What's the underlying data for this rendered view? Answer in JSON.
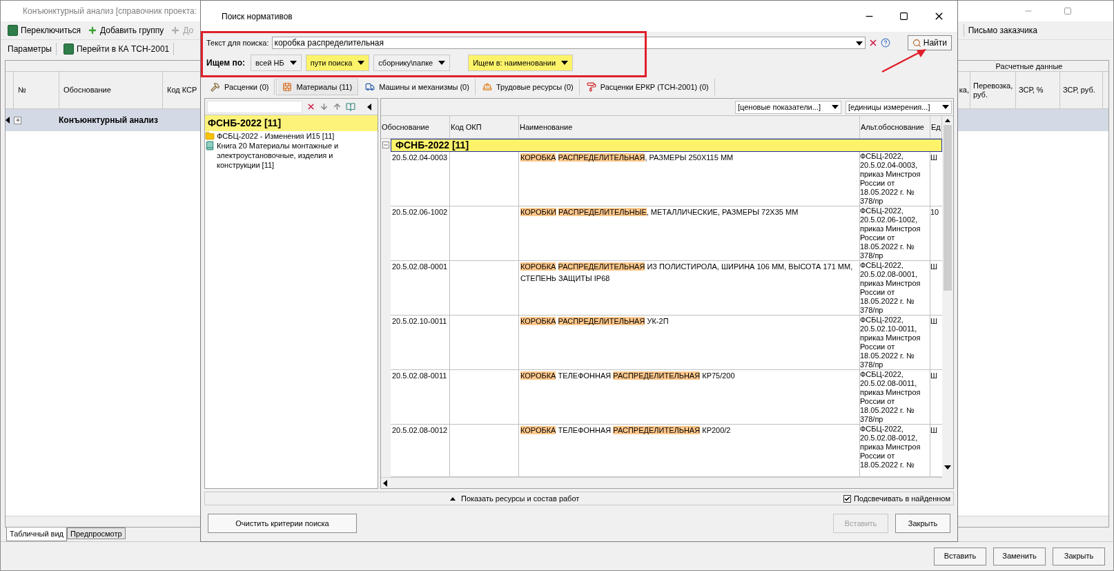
{
  "background_window": {
    "title": "Конъюнктурный анализ [справочник проекта:",
    "toolbar_1": [
      {
        "label": "Переключиться",
        "kind": "app",
        "disabled": false
      },
      {
        "label": "Добавить группу",
        "kind": "add",
        "disabled": false
      },
      {
        "label": "До",
        "kind": "add",
        "disabled": true
      }
    ],
    "letter_button": "Письмо заказчика",
    "toolbar_2": [
      {
        "label": "Параметры",
        "kind": "plain"
      },
      {
        "label": "Перейти в КА ТСН-2001",
        "kind": "app"
      }
    ],
    "table": {
      "group_header": "Расчетные данные",
      "columns_left": [
        "№",
        "Обоснование",
        "Код КСР"
      ],
      "columns_right": [
        "ка,",
        "Перевозка, руб.",
        "ЗСР, %",
        "ЗСР, руб."
      ],
      "rows": [
        {
          "title": "Конъюнктурный анализ",
          "selected": true,
          "expanded": false
        }
      ]
    },
    "view_tabs": [
      {
        "label": "Табличный вид",
        "selected": true
      },
      {
        "label": "Предпросмотр",
        "selected": false
      }
    ],
    "buttons": [
      "Вставить",
      "Заменить",
      "Закрыть"
    ]
  },
  "dialog": {
    "title": "Поиск нормативов",
    "search": {
      "label": "Текст для поиска:",
      "value": "коробка распределительная",
      "find_button": "Найти"
    },
    "filters": {
      "label": "Ищем по:",
      "dropdowns": [
        {
          "label": "всей НБ",
          "highlighted": false
        },
        {
          "label": "пути поиска",
          "highlighted": true
        },
        {
          "label": "сборнику\\папке",
          "highlighted": false
        },
        {
          "label": "Ищем в: наименовании",
          "highlighted": true
        }
      ]
    },
    "tabs": [
      {
        "label": "Расценки (0)",
        "kind": "hammer",
        "selected": false
      },
      {
        "label": "Материалы (11)",
        "kind": "bricks",
        "selected": true
      },
      {
        "label": "Машины и механизмы (0)",
        "kind": "truck",
        "selected": false
      },
      {
        "label": "Трудовые ресурсы (0)",
        "kind": "worker",
        "selected": false
      },
      {
        "label": "Расценки ЕРКР (ТСН-2001) (0)",
        "kind": "roller",
        "selected": false
      }
    ],
    "tree": [
      {
        "label": "ФСНБ-2022 [11]",
        "selected": true,
        "children": [
          {
            "label": "ФСБЦ-2022 - Изменения И15 [11]",
            "kind": "folder",
            "selected": false
          },
          {
            "label": "Книга 20 Материалы монтажные и электроустановочные, изделия и конструкции [11]",
            "kind": "book",
            "selected": false
          }
        ]
      }
    ],
    "grid": {
      "filters": [
        "[ценовые показатели...]",
        "[единицы измерения...]"
      ],
      "columns": [
        "Обоснование",
        "Код ОКП",
        "Наименование",
        "Альт.обоснование",
        "Ед"
      ],
      "group": {
        "label": "ФСНБ-2022 [11]",
        "expanded": true
      },
      "rows": [
        {
          "code": "20.5.02.04-0003",
          "name": [
            {
              "text": "КОРОБКА",
              "highlighted": true
            },
            {
              "text": " РАСПРЕДЕЛИТЕЛЬНАЯ",
              "highlighted": true
            },
            {
              "text": ", РАЗМЕРЫ 250Х115 ММ",
              "highlighted": false
            }
          ],
          "alt": "ФСБЦ-2022, 20.5.02.04-0003, приказ Минстроя России от 18.05.2022 г. № 378/пр",
          "unit": "Ш"
        },
        {
          "code": "20.5.02.06-1002",
          "name": [
            {
              "text": "КОРОБКИ",
              "highlighted": true
            },
            {
              "text": " РАСПРЕДЕЛИТЕЛЬНЫЕ",
              "highlighted": true
            },
            {
              "text": ", МЕТАЛЛИЧЕСКИЕ, РАЗМЕРЫ 72Х35 ММ",
              "highlighted": false
            }
          ],
          "alt": "ФСБЦ-2022, 20.5.02.06-1002, приказ Минстроя России от 18.05.2022 г. № 378/пр",
          "unit": "10"
        },
        {
          "code": "20.5.02.08-0001",
          "name": [
            {
              "text": "КОРОБКА",
              "highlighted": true
            },
            {
              "text": " РАСПРЕДЕЛИТЕЛЬНАЯ",
              "highlighted": true
            },
            {
              "text": " ИЗ ПОЛИСТИРОЛА, ШИРИНА 106 ММ, ВЫСОТА 171 ММ, СТЕПЕНЬ ЗАЩИТЫ IP68",
              "highlighted": false
            }
          ],
          "alt": "ФСБЦ-2022, 20.5.02.08-0001, приказ Минстроя России от 18.05.2022 г. № 378/пр",
          "unit": "Ш"
        },
        {
          "code": "20.5.02.10-0011",
          "name": [
            {
              "text": "КОРОБКА",
              "highlighted": true
            },
            {
              "text": " РАСПРЕДЕЛИТЕЛЬНАЯ",
              "highlighted": true
            },
            {
              "text": " УК-2П",
              "highlighted": false
            }
          ],
          "alt": "ФСБЦ-2022, 20.5.02.10-0011, приказ Минстроя России от 18.05.2022 г. № 378/пр",
          "unit": "Ш"
        },
        {
          "code": "20.5.02.08-0011",
          "name": [
            {
              "text": "КОРОБКА",
              "highlighted": true
            },
            {
              "text": " ТЕЛЕФОННАЯ ",
              "highlighted": false
            },
            {
              "text": "РАСПРЕДЕЛИТЕЛЬНАЯ",
              "highlighted": true
            },
            {
              "text": " КР75/200",
              "highlighted": false
            }
          ],
          "alt": "ФСБЦ-2022, 20.5.02.08-0011, приказ Минстроя России от 18.05.2022 г. № 378/пр",
          "unit": "Ш"
        },
        {
          "code": "20.5.02.08-0012",
          "name": [
            {
              "text": "КОРОБКА",
              "highlighted": true
            },
            {
              "text": " ТЕЛЕФОННАЯ ",
              "highlighted": false
            },
            {
              "text": "РАСПРЕДЕЛИТЕЛЬНАЯ",
              "highlighted": true
            },
            {
              "text": " КР200/2",
              "highlighted": false
            }
          ],
          "alt": "ФСБЦ-2022, 20.5.02.08-0012, приказ Минстроя России от 18.05.2022 г. №",
          "unit": "Ш"
        }
      ]
    },
    "footer": {
      "toggle": "Показать ресурсы и состав работ",
      "highlight_checkbox": {
        "label": "Подсвечивать в найденном",
        "checked": true
      }
    },
    "buttons": [
      {
        "label": "Очистить критерии поиска",
        "disabled": false
      },
      {
        "label": "Вставить",
        "disabled": true
      },
      {
        "label": "Закрыть",
        "disabled": false
      }
    ]
  }
}
